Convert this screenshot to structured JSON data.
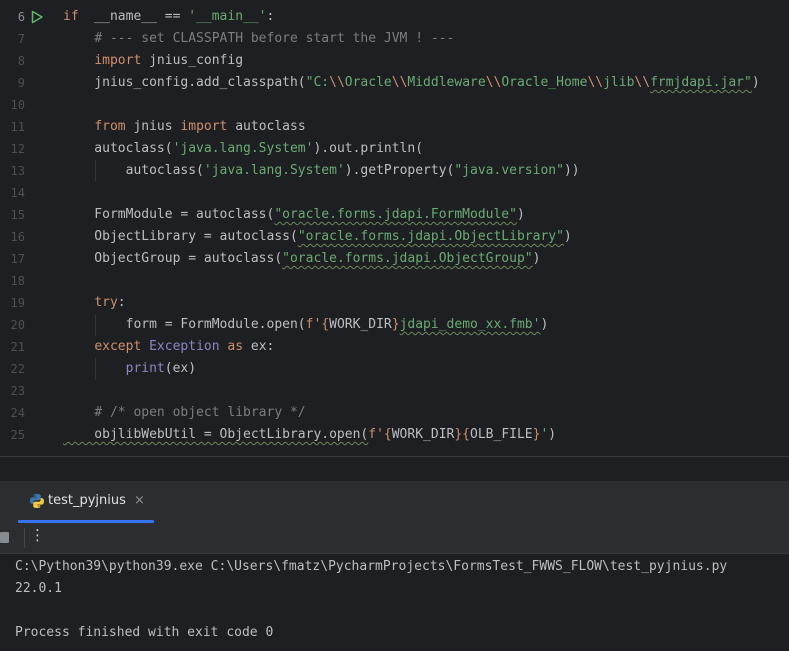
{
  "editor": {
    "lines": [
      {
        "n": "6",
        "active": true,
        "has_run": true,
        "tokens": [
          [
            "kw",
            "if"
          ],
          [
            "",
            "  __name__ == "
          ],
          [
            "str",
            "'__main__'"
          ],
          [
            "",
            ":"
          ]
        ]
      },
      {
        "n": "7",
        "tokens": [
          [
            "",
            "    "
          ],
          [
            "cmt",
            "# --- set CLASSPATH before start the JVM ! ---"
          ]
        ]
      },
      {
        "n": "8",
        "tokens": [
          [
            "",
            "    "
          ],
          [
            "kw",
            "import"
          ],
          [
            "",
            " jnius_config"
          ]
        ]
      },
      {
        "n": "9",
        "tokens": [
          [
            "",
            "    jnius_config.add_classpath("
          ],
          [
            "str",
            "\"C:"
          ],
          [
            "esc",
            "\\\\"
          ],
          [
            "str",
            "Oracle"
          ],
          [
            "esc",
            "\\\\"
          ],
          [
            "str",
            "Middleware"
          ],
          [
            "esc",
            "\\\\"
          ],
          [
            "str",
            "Oracle_Home"
          ],
          [
            "esc",
            "\\\\"
          ],
          [
            "str",
            "jlib"
          ],
          [
            "esc",
            "\\\\"
          ],
          [
            "str",
            "frmjdapi.jar\""
          ],
          [
            "",
            ")"
          ]
        ]
      },
      {
        "n": "10",
        "tokens": []
      },
      {
        "n": "11",
        "tokens": [
          [
            "",
            "    "
          ],
          [
            "kw",
            "from"
          ],
          [
            "",
            " jnius "
          ],
          [
            "kw",
            "import"
          ],
          [
            "",
            " autoclass"
          ]
        ]
      },
      {
        "n": "12",
        "tokens": [
          [
            "",
            "    autoclass("
          ],
          [
            "str",
            "'java.lang.System'"
          ],
          [
            "",
            ").out.println("
          ]
        ]
      },
      {
        "n": "13",
        "tokens": [
          [
            "",
            "        autoclass("
          ],
          [
            "str",
            "'java.lang.System'"
          ],
          [
            "",
            ").getProperty("
          ],
          [
            "str",
            "\"java.version\""
          ],
          [
            "",
            "))"
          ]
        ]
      },
      {
        "n": "14",
        "tokens": []
      },
      {
        "n": "15",
        "tokens": [
          [
            "",
            "    FormModule = autoclass("
          ],
          [
            "str",
            "\"oracle.forms.jdapi.FormModule\""
          ],
          [
            "",
            ")"
          ]
        ]
      },
      {
        "n": "16",
        "tokens": [
          [
            "",
            "    ObjectLibrary = autoclass("
          ],
          [
            "str",
            "\"oracle.forms.jdapi.ObjectLibrary\""
          ],
          [
            "",
            ")"
          ]
        ]
      },
      {
        "n": "17",
        "tokens": [
          [
            "",
            "    ObjectGroup = autoclass("
          ],
          [
            "str",
            "\"oracle.forms.jdapi.ObjectGroup\""
          ],
          [
            "",
            ")"
          ]
        ]
      },
      {
        "n": "18",
        "tokens": []
      },
      {
        "n": "19",
        "tokens": [
          [
            "",
            "    "
          ],
          [
            "kw",
            "try"
          ],
          [
            "",
            ":"
          ]
        ]
      },
      {
        "n": "20",
        "tokens": [
          [
            "",
            "        form = FormModule.open("
          ],
          [
            "fb",
            "f'"
          ],
          [
            "kw",
            "{"
          ],
          [
            "",
            "WORK_DIR"
          ],
          [
            "kw",
            "}"
          ],
          [
            "str",
            "jdapi_demo_xx.fmb'"
          ],
          [
            "",
            ")"
          ]
        ]
      },
      {
        "n": "21",
        "tokens": [
          [
            "",
            "    "
          ],
          [
            "kw",
            "except"
          ],
          [
            "",
            " "
          ],
          [
            "bi",
            "Exception"
          ],
          [
            "",
            " "
          ],
          [
            "kw",
            "as"
          ],
          [
            "",
            " ex:"
          ]
        ]
      },
      {
        "n": "22",
        "tokens": [
          [
            "",
            "        "
          ],
          [
            "bi",
            "print"
          ],
          [
            "",
            "(ex)"
          ]
        ]
      },
      {
        "n": "23",
        "tokens": []
      },
      {
        "n": "24",
        "tokens": [
          [
            "",
            "    "
          ],
          [
            "cmt",
            "# /* open object library */"
          ]
        ]
      },
      {
        "n": "25",
        "tokens": [
          [
            "",
            "    objlibWebUtil = ObjectLibrary.open("
          ],
          [
            "fb",
            "f'"
          ],
          [
            "kw",
            "{"
          ],
          [
            "",
            "WORK_DIR"
          ],
          [
            "kw",
            "}{"
          ],
          [
            "",
            "OLB_FILE"
          ],
          [
            "kw",
            "}"
          ],
          [
            "str",
            "'"
          ],
          [
            "",
            ")"
          ]
        ]
      }
    ]
  },
  "run_window": {
    "tab_label": "test_pyjnius",
    "close_glyph": "×",
    "more_glyph": "⋮",
    "icons": {
      "tab": "python-icon",
      "stop": "stop-icon"
    }
  },
  "console": {
    "lines": [
      "C:\\Python39\\python39.exe C:\\Users\\fmatz\\PycharmProjects\\FormsTest_FWWS_FLOW\\test_pyjnius.py",
      "22.0.1",
      "",
      "Process finished with exit code 0"
    ]
  },
  "colors": {
    "keyword": "#cf8e6d",
    "string": "#6aab73",
    "comment": "#7a7e85",
    "builtin": "#8888c6",
    "text": "#bcbec4",
    "accent": "#3574f0"
  }
}
